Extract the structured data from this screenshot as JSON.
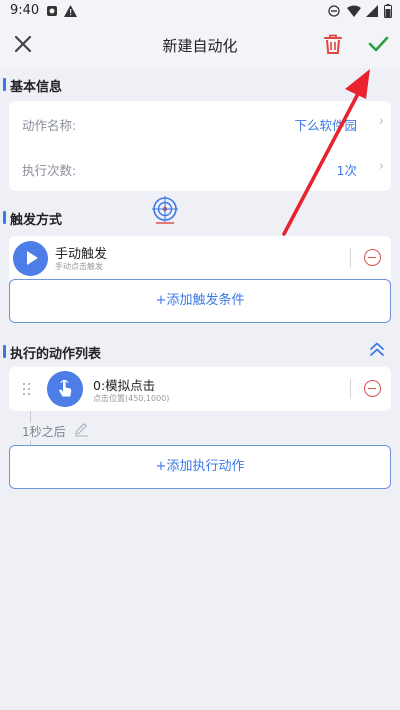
{
  "status_bar": {
    "time": "9:40"
  },
  "app_bar": {
    "title": "新建自动化"
  },
  "basic_info": {
    "section_title": "基本信息",
    "rows": [
      {
        "label": "动作名称:",
        "value": "下么软件园"
      },
      {
        "label": "执行次数:",
        "value": "1次"
      }
    ]
  },
  "trigger": {
    "section_title": "触发方式",
    "item_title": "手动触发",
    "item_subtitle": "手动点击触发",
    "add_label": "+添加触发条件"
  },
  "actions": {
    "section_title": "执行的动作列表",
    "item_title": "0:模拟点击",
    "item_subtitle": "点击位置(450,1000)",
    "delay_label": "1秒之后",
    "add_label": "+添加执行动作"
  },
  "colors": {
    "accent": "#3b78e7",
    "delete": "#d8534f",
    "confirm": "#2e9d45",
    "annotation_arrow": "#e8232f",
    "background": "#eef0f5"
  },
  "icons": {
    "close": "close-icon",
    "delete": "trash-icon",
    "confirm": "check-icon",
    "play": "play-icon",
    "tap": "tap-hand-icon",
    "remove": "minus-circle-icon",
    "collapse": "double-chevron-up-icon",
    "edit": "pencil-icon",
    "drag": "drag-handle-icon"
  }
}
